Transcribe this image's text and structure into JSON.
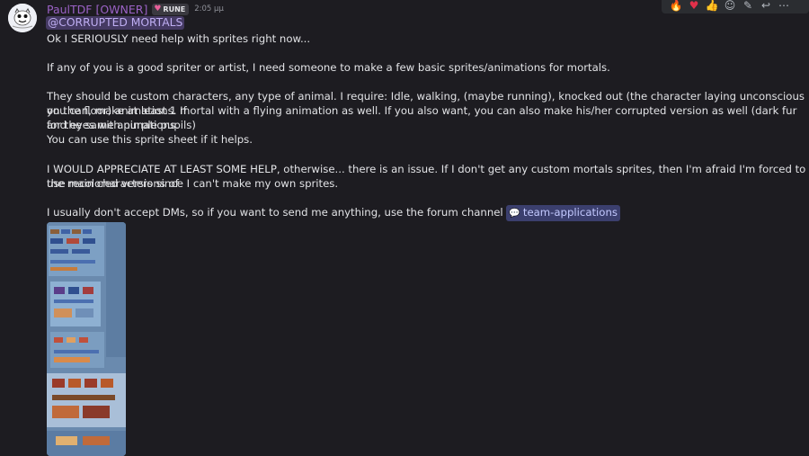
{
  "message": {
    "author": "PaulTDF [OWNER]",
    "role_badge": "RUNE",
    "timestamp": "2:05 μμ",
    "mention": "@CORRUPTED MORTALS",
    "lines": [
      "Ok I SERIOUSLY need help with sprites right now...",
      "If any of you is a good spriter or artist, I need someone to make a few basic sprites/animations for mortals.",
      "They should be custom characters, any type of animal. I require: Idle, walking, (maybe running), knocked out (the character laying unconscious on the floor) animations. If",
      "you can, make at least 1 mortal with a flying animation as well. If you also want, you can also make his/her corrupted version as well (dark fur and eyes with purple pupils)",
      "for the same animations.",
      "You can use this sprite sheet if it helps.",
      "I WOULD APPRECIATE AT LEAST SOME HELP, otherwise... there is an issue. If I don't get any custom mortals sprites, then I'm afraid I'm forced to use recolored versions of",
      "the main characters since I can't make my own sprites.",
      "I usually don't accept DMs, so if you want to send me anything, use the forum channel"
    ],
    "channel_mention": "team-applications"
  },
  "colors": {
    "background": "#1d1c21",
    "username": "#9b62c6",
    "mention_bg": "#453a63",
    "channel_mention_bg": "#3b3f6e"
  },
  "icons": {
    "role_badge_icon": "heart-icon",
    "channel_icon": "forum-icon",
    "toolbar": [
      "fire-reaction-icon",
      "heart-reaction-icon",
      "thumbs-up-reaction-icon",
      "add-reaction-icon",
      "edit-icon",
      "reply-icon",
      "more-icon"
    ]
  }
}
